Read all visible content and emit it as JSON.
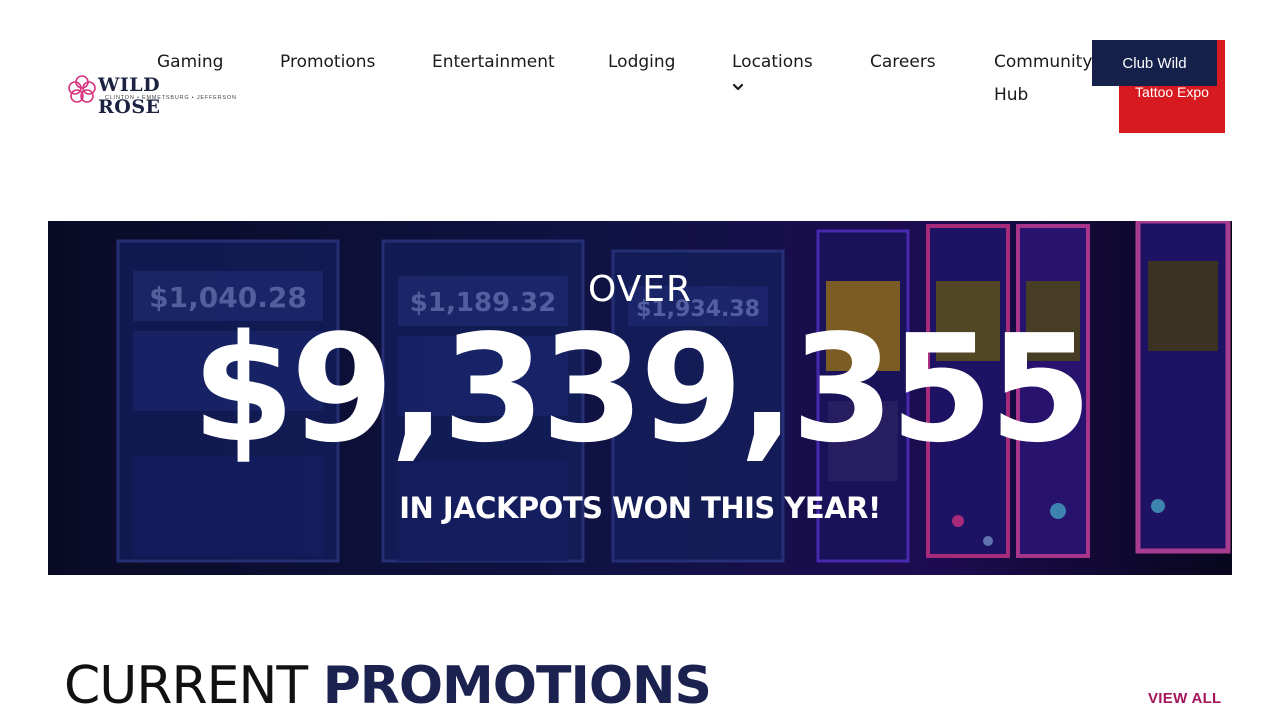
{
  "logo": {
    "name": "WILD ROSE",
    "tagline": "CLINTON • EMMETSBURG • JEFFERSON",
    "color": "#d6337f"
  },
  "nav": {
    "items": [
      {
        "label": "Gaming"
      },
      {
        "label": "Promotions"
      },
      {
        "label": "Entertainment"
      },
      {
        "label": "Lodging"
      },
      {
        "label": "Locations"
      },
      {
        "label": "Careers"
      },
      {
        "label": "Community Hub"
      }
    ],
    "locations_icon": "chevron-down-icon"
  },
  "buttons": {
    "club_wild": "Club Wild",
    "tattoo_expo": "Tattoo Expo",
    "club_color": "#16214b",
    "tattoo_color": "#d71920"
  },
  "hero": {
    "over": "OVER",
    "amount": "$9,339,355",
    "caption": "IN JACKPOTS WON THIS YEAR!",
    "machines": [
      {
        "display": "$1,040.28"
      },
      {
        "display": "$1,189.32"
      },
      {
        "display": "$1,934.38"
      }
    ]
  },
  "promotions": {
    "title_light": "CURRENT",
    "title_bold": "PROMOTIONS",
    "view_all": "VIEW ALL",
    "accent": "#a4155a"
  }
}
